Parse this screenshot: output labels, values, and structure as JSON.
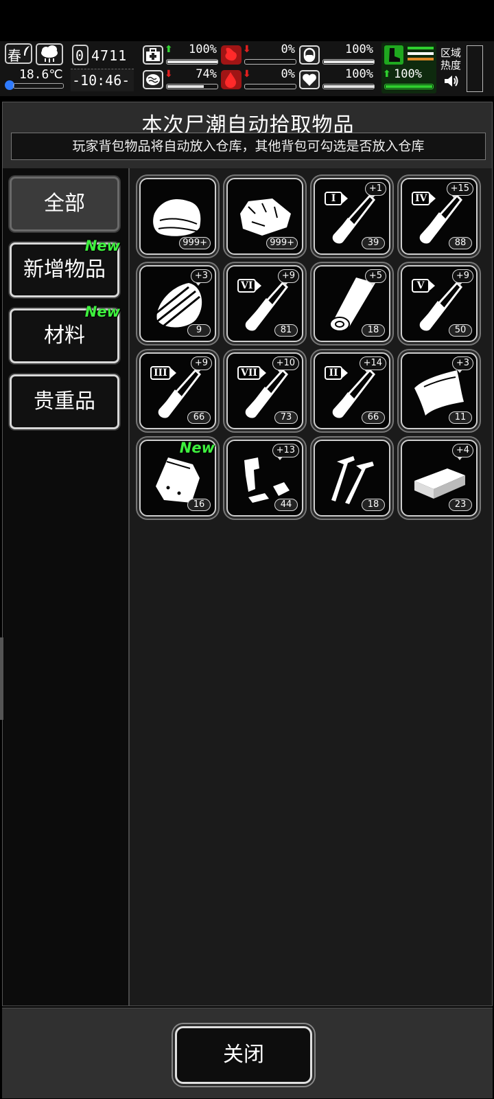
{
  "hud": {
    "season": "春",
    "temperature": "18.6℃",
    "day_counter": "0",
    "day_digits": "4711",
    "clock": "-10:46-",
    "stats": [
      {
        "name": "health",
        "icon": "medkit-icon",
        "arrow": "up",
        "arrow_color": "#34d234",
        "value": "100%",
        "fill": 1.0
      },
      {
        "name": "hunger",
        "icon": "stomach-icon",
        "arrow": "down",
        "arrow_color": "#e02020",
        "value": "0%",
        "fill": 0.0
      },
      {
        "name": "armor",
        "icon": "capsule-icon",
        "arrow": "",
        "arrow_color": "#ffffff",
        "value": "100%",
        "fill": 1.0
      },
      {
        "name": "sanity",
        "icon": "brain-icon",
        "arrow": "down",
        "arrow_color": "#e02020",
        "value": "74%",
        "fill": 0.74
      },
      {
        "name": "thirst",
        "icon": "blood-drop-icon",
        "arrow": "down",
        "arrow_color": "#e02020",
        "value": "0%",
        "fill": 0.0
      },
      {
        "name": "mood",
        "icon": "heart-icon",
        "arrow": "",
        "arrow_color": "#ffffff",
        "value": "100%",
        "fill": 1.0
      }
    ],
    "stamina": {
      "arrow": "up",
      "value": "100%",
      "fill": 1.0
    },
    "zone_heat_label_1": "区域",
    "zone_heat_label_2": "热度"
  },
  "dialog": {
    "title": "本次尸潮自动拾取物品",
    "subtitle": "玩家背包物品将自动放入仓库，其他背包可勾选是否放入仓库",
    "close_label": "关闭"
  },
  "categories": [
    {
      "label": "全部",
      "selected": true,
      "new": ""
    },
    {
      "label": "新增物品",
      "selected": false,
      "new": "New"
    },
    {
      "label": "材料",
      "selected": false,
      "new": "New"
    },
    {
      "label": "贵重品",
      "selected": false,
      "new": ""
    }
  ],
  "items": [
    {
      "name": "cloth",
      "icon": "cloth-icon",
      "count": "999+",
      "bonus": "",
      "roman": "",
      "new": ""
    },
    {
      "name": "raw-meat",
      "icon": "meat-icon",
      "count": "999+",
      "bonus": "",
      "roman": "",
      "new": ""
    },
    {
      "name": "vial-1",
      "icon": "test-tube-icon",
      "count": "39",
      "bonus": "+1",
      "roman": "I",
      "new": ""
    },
    {
      "name": "vial-4",
      "icon": "test-tube-icon",
      "count": "88",
      "bonus": "+15",
      "roman": "IV",
      "new": ""
    },
    {
      "name": "wood-plank",
      "icon": "wood-scrap-icon",
      "count": "9",
      "bonus": "+3",
      "roman": "",
      "new": ""
    },
    {
      "name": "vial-6",
      "icon": "test-tube-icon",
      "count": "81",
      "bonus": "+9",
      "roman": "VI",
      "new": ""
    },
    {
      "name": "log",
      "icon": "log-icon",
      "count": "18",
      "bonus": "+5",
      "roman": "",
      "new": ""
    },
    {
      "name": "vial-5",
      "icon": "test-tube-icon",
      "count": "50",
      "bonus": "+9",
      "roman": "V",
      "new": ""
    },
    {
      "name": "vial-3",
      "icon": "test-tube-icon",
      "count": "66",
      "bonus": "+9",
      "roman": "III",
      "new": ""
    },
    {
      "name": "vial-7",
      "icon": "test-tube-icon",
      "count": "73",
      "bonus": "+10",
      "roman": "VII",
      "new": ""
    },
    {
      "name": "vial-2",
      "icon": "test-tube-icon",
      "count": "66",
      "bonus": "+14",
      "roman": "II",
      "new": ""
    },
    {
      "name": "leather",
      "icon": "leather-sheet-icon",
      "count": "11",
      "bonus": "+3",
      "roman": "",
      "new": ""
    },
    {
      "name": "sack",
      "icon": "sack-icon",
      "count": "16",
      "bonus": "",
      "roman": "",
      "new": "New"
    },
    {
      "name": "scrap-parts",
      "icon": "scrap-metal-icon",
      "count": "44",
      "bonus": "+13",
      "roman": "",
      "new": ""
    },
    {
      "name": "nails",
      "icon": "nails-icon",
      "count": "18",
      "bonus": "",
      "roman": "",
      "new": ""
    },
    {
      "name": "brick",
      "icon": "brick-icon",
      "count": "23",
      "bonus": "+4",
      "roman": "",
      "new": ""
    }
  ],
  "colors": {
    "new_tag": "#3ef03e",
    "up_arrow": "#34d234",
    "down_arrow": "#e02020",
    "stamina_bar": "#2fd02f",
    "stamina_icon": "#1fa81f",
    "stripe_orange": "#e08a2a"
  }
}
